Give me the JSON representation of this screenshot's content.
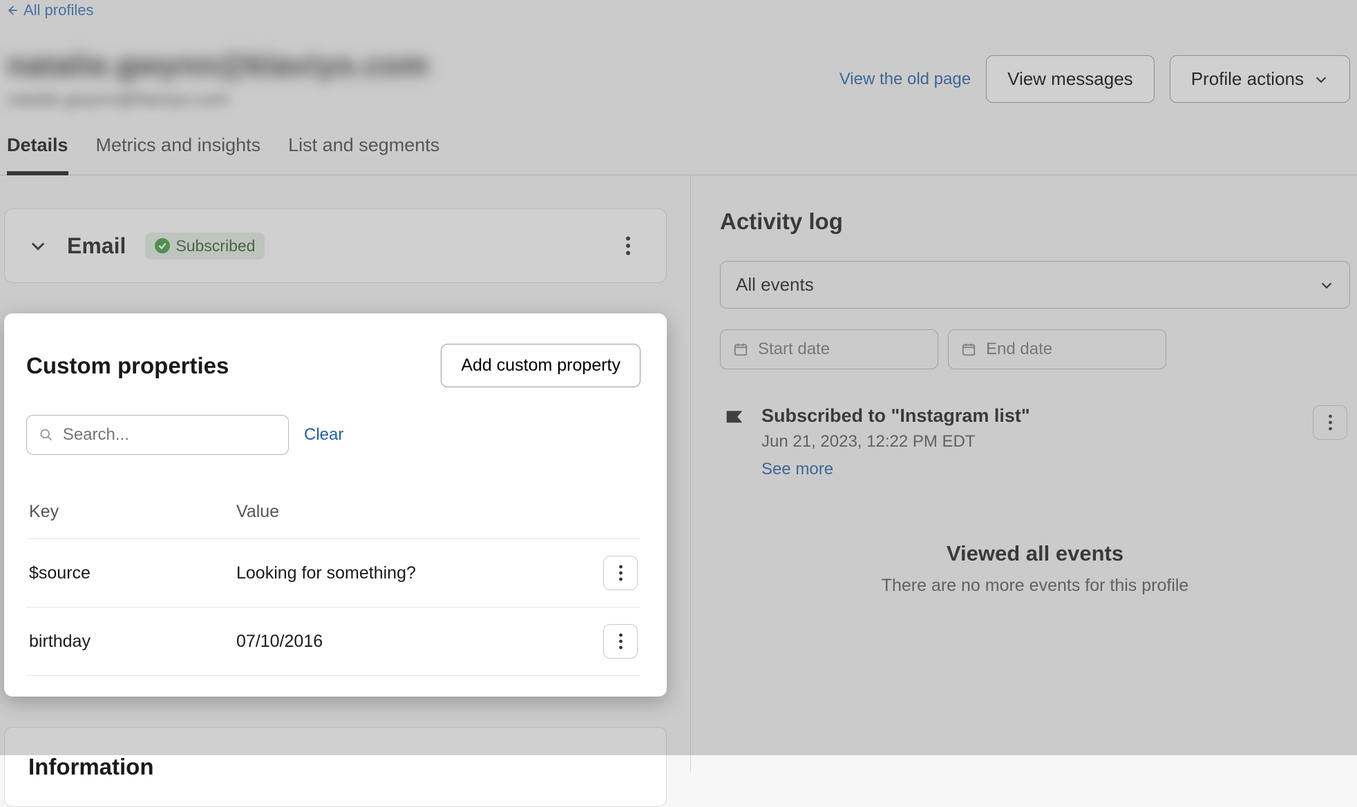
{
  "nav": {
    "back_label": "All profiles"
  },
  "header": {
    "title_blurred": "natalie.gwynn@klaviyo.com",
    "sub_blurred": "natalie.gwynn@klaviyo.com",
    "old_page_link": "View the old page",
    "view_messages": "View messages",
    "profile_actions": "Profile actions"
  },
  "tabs": [
    {
      "label": "Details",
      "active": true
    },
    {
      "label": "Metrics and insights",
      "active": false
    },
    {
      "label": "List and segments",
      "active": false
    }
  ],
  "email_card": {
    "title": "Email",
    "status": "Subscribed"
  },
  "custom_properties": {
    "title": "Custom properties",
    "add_button": "Add custom property",
    "search_placeholder": "Search...",
    "clear": "Clear",
    "columns": {
      "key": "Key",
      "value": "Value"
    },
    "rows": [
      {
        "key": "$source",
        "value": "Looking for something?"
      },
      {
        "key": "birthday",
        "value": "07/10/2016"
      }
    ]
  },
  "information": {
    "title": "Information"
  },
  "activity_log": {
    "title": "Activity log",
    "filter_select": "All events",
    "start_date_placeholder": "Start date",
    "end_date_placeholder": "End date",
    "events": [
      {
        "title": "Subscribed to \"Instagram list\"",
        "timestamp": "Jun 21, 2023, 12:22 PM EDT",
        "see_more": "See more"
      }
    ],
    "end_heading": "Viewed all events",
    "end_sub": "There are no more events for this profile"
  },
  "colors": {
    "link": "#1f5fa8",
    "pill_bg": "#e3efe3",
    "pill_fg": "#2c5a2c",
    "pill_dot": "#3c9a3c"
  }
}
